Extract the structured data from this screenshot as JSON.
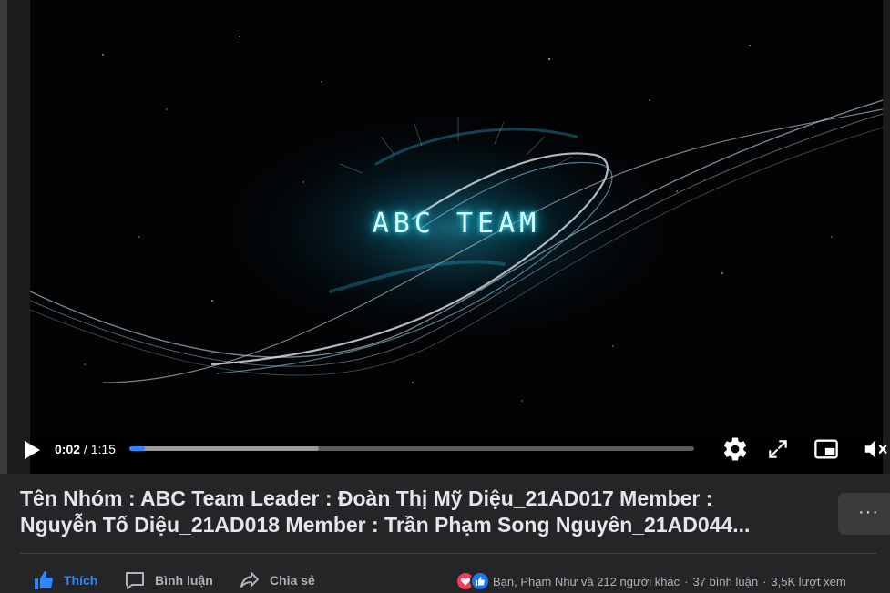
{
  "video": {
    "overlay_title": "ABC TEAM",
    "current_time": "0:02",
    "separator": "/",
    "duration": "1:15",
    "played_fraction": 0.027,
    "buffered_fraction": 0.335
  },
  "post": {
    "caption_line1": "Tên Nhóm : ABC Team Leader : Đoàn Thị Mỹ Diệu_21AD017 Member :",
    "caption_line2": "Nguyễn Tố Diệu_21AD018 Member : Trần Phạm Song Nguyên_21AD044...",
    "more_label": "···"
  },
  "actions": {
    "like_label": "Thích",
    "comment_label": "Bình luận",
    "share_label": "Chia sẻ"
  },
  "stats": {
    "reactions_text": "Bạn, Phạm Như và 212 người khác",
    "comments_text": "37 bình luận",
    "views_text": "3,5K lượt xem"
  },
  "colors": {
    "accent": "#2d88ff",
    "background": "#242526",
    "love": "#f33e58"
  }
}
